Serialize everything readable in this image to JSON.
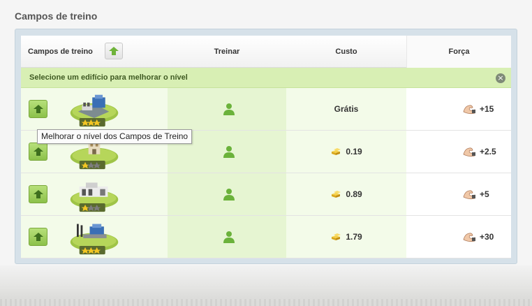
{
  "section_title": "Campos de treino",
  "header": {
    "campos": "Campos de treino",
    "treinar": "Treinar",
    "custo": "Custo",
    "forca": "Força"
  },
  "notice": {
    "text": "Selecione um edifício para melhorar o nível",
    "close_icon": "close-icon"
  },
  "tooltip": "Melhorar o nível dos Campos de Treino",
  "colors": {
    "accent_green": "#8cc14a",
    "notice_bg": "#d8efb4",
    "star_gold": "#f3c623"
  },
  "rows": [
    {
      "stars": 3,
      "cost": "Grátis",
      "show_gold": false,
      "forca": "+15"
    },
    {
      "stars": 1,
      "cost": "0.19",
      "show_gold": true,
      "forca": "+2.5"
    },
    {
      "stars": 1,
      "cost": "0.89",
      "show_gold": true,
      "forca": "+5"
    },
    {
      "stars": 3,
      "cost": "1.79",
      "show_gold": true,
      "forca": "+30"
    }
  ]
}
